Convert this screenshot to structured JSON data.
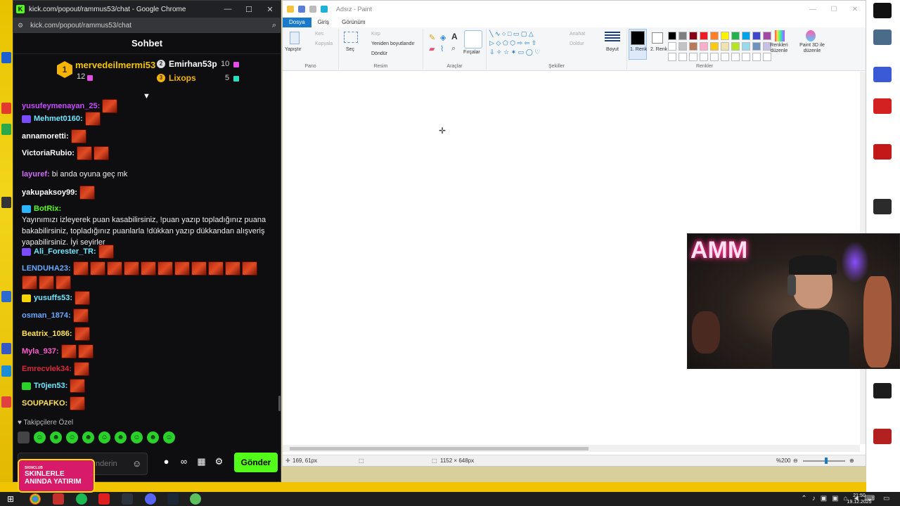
{
  "colors": {
    "kick_green": "#53fc18",
    "paint_blue": "#1979ca",
    "chat_bg": "#0e0e10"
  },
  "chrome": {
    "title": "kick.com/popout/rammus53/chat - Google Chrome",
    "url": "kick.com/popout/rammus53/chat",
    "controls": {
      "minimize": "—",
      "maximize": "☐",
      "close": "✕"
    }
  },
  "chat": {
    "header": "Sohbet",
    "leaderboard": {
      "first": {
        "rank": "1",
        "name": "mervedeilmermi53",
        "count": "12"
      },
      "second": {
        "rank": "2",
        "name": "Emirhan53p",
        "count": "10"
      },
      "third": {
        "rank": "3",
        "name": "Lixops",
        "count": "5"
      }
    },
    "messages": [
      {
        "user": "yusufeymenayan_25:",
        "text": "",
        "emotes": 1,
        "color": "#c64bff"
      },
      {
        "user": "Mehmet0160:",
        "text": "",
        "emotes": 1,
        "color": "#6ee7ff",
        "badge": "#7b4cff"
      },
      {
        "user": "annamoretti:",
        "text": "",
        "emotes": 1,
        "color": "#ffffff"
      },
      {
        "user": "VictoriaRubio:",
        "text": "",
        "emotes": 2,
        "color": "#ffffff"
      },
      {
        "user": "layuref:",
        "text": "bi anda oyuna geç mk",
        "emotes": 0,
        "color": "#d46bff"
      },
      {
        "user": "yakupaksoy99:",
        "text": "",
        "emotes": 1,
        "color": "#ffffff"
      },
      {
        "user": "BotRix:",
        "text": "Yayınımızı izleyerek puan kasabilirsiniz, !puan yazıp topladığınız puana bakabilirsiniz, topladığınız puanlarla !dükkan yazıp dükkandan alışveriş yapabilirsiniz. İyi seyirler",
        "emotes": 0,
        "color": "#53fc18",
        "badge": "#2bb5ff"
      },
      {
        "user": "Ali_Forester_TR:",
        "text": "",
        "emotes": 1,
        "color": "#6ee7ff",
        "badge": "#7b4cff"
      },
      {
        "user": "LENDUHA23:",
        "text": "",
        "emotes": 14,
        "color": "#6aa8ff"
      },
      {
        "user": "yusuffs53:",
        "text": "",
        "emotes": 1,
        "color": "#6ee7ff",
        "badge": "#f5d400"
      },
      {
        "user": "osman_1874:",
        "text": "",
        "emotes": 1,
        "color": "#6aa8ff"
      },
      {
        "user": "Beatrix_1086:",
        "text": "",
        "emotes": 1,
        "color": "#ffe15a"
      },
      {
        "user": "Myla_937:",
        "text": "",
        "emotes": 2,
        "color": "#ff5ccf"
      },
      {
        "user": "Emrecvlek34:",
        "text": "",
        "emotes": 1,
        "color": "#d9283a"
      },
      {
        "user": "Tr0jen53:",
        "text": "",
        "emotes": 1,
        "color": "#6ee7ff",
        "badge": "#2bd12b"
      },
      {
        "user": "SOUPAFKO:",
        "text": "",
        "emotes": 1,
        "color": "#ffe15a"
      }
    ],
    "followers_only": "♥ Takipçilere Özel",
    "input_placeholder": "nderin",
    "send_label": "Gönder",
    "promo": {
      "brand": "SKINCLUB",
      "line1": "SKINLERLE",
      "line2": "ANINDA YATIRIM"
    }
  },
  "paint": {
    "title": "Adsız - Paint",
    "tabs": [
      "Dosya",
      "Giriş",
      "Görünüm"
    ],
    "ribbon": {
      "pano": {
        "label": "Pano",
        "paste": "Yapıştır",
        "cut": "Kes",
        "copy": "Kopyala"
      },
      "resim": {
        "label": "Resim",
        "select": "Seç",
        "crop": "Kırp",
        "resize": "Yeniden boyutlandır",
        "rotate": "Döndür"
      },
      "araclar": {
        "label": "Araçlar",
        "brushes": "Fırçalar"
      },
      "sekiller": {
        "label": "Şekiller",
        "outline": "Anahat",
        "fill": "Doldur",
        "size": "Boyut"
      },
      "renkler": {
        "label": "Renkler",
        "color1": "1. Renk",
        "color2": "2. Renk",
        "edit_colors": "Renkleri düzenle",
        "paint3d": "Paint 3D ile düzenle"
      }
    },
    "palette": [
      "#000000",
      "#7f7f7f",
      "#880015",
      "#ed1c24",
      "#ff7f27",
      "#fff200",
      "#22b14c",
      "#00a2e8",
      "#3f48cc",
      "#a349a4",
      "#ffffff",
      "#c3c3c3",
      "#b97a57",
      "#ffaec9",
      "#ffc90e",
      "#efe4b0",
      "#b5e61d",
      "#99d9ea",
      "#7092be",
      "#c8bfe7"
    ],
    "status": {
      "cursor_pos": "169, 61px",
      "canvas_size": "1152 × 648px",
      "zoom": "%200"
    }
  },
  "webcam": {
    "neon_text": "AMM"
  },
  "taskbar": {
    "time": "21:50",
    "date": "19.12.2025"
  }
}
